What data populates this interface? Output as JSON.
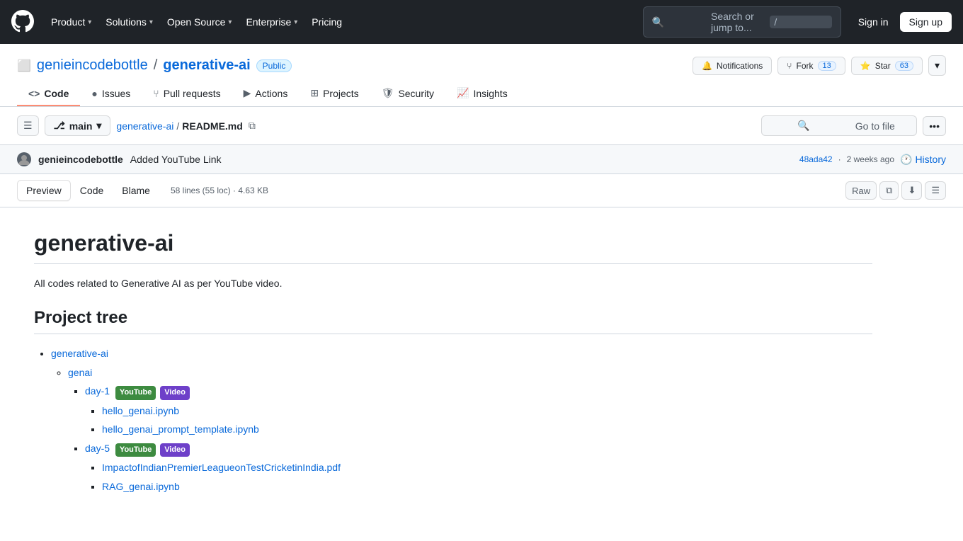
{
  "app": {
    "title": "GitHub",
    "logo_label": "GitHub logo"
  },
  "nav": {
    "items": [
      {
        "label": "Product",
        "has_dropdown": true
      },
      {
        "label": "Solutions",
        "has_dropdown": true
      },
      {
        "label": "Open Source",
        "has_dropdown": true
      },
      {
        "label": "Enterprise",
        "has_dropdown": true
      },
      {
        "label": "Pricing",
        "has_dropdown": false
      }
    ],
    "search_placeholder": "Search or jump to...",
    "search_shortcut": "/",
    "signin_label": "Sign in",
    "signup_label": "Sign up"
  },
  "repo": {
    "owner": "genieincodebottle",
    "name": "generative-ai",
    "visibility": "Public",
    "notifications_label": "Notifications",
    "fork_label": "Fork",
    "fork_count": "13",
    "star_label": "Star",
    "star_count": "63",
    "tabs": [
      {
        "label": "Code",
        "icon": "code-icon",
        "active": true
      },
      {
        "label": "Issues",
        "icon": "issue-icon",
        "active": false
      },
      {
        "label": "Pull requests",
        "icon": "pr-icon",
        "active": false
      },
      {
        "label": "Actions",
        "icon": "actions-icon",
        "active": false
      },
      {
        "label": "Projects",
        "icon": "projects-icon",
        "active": false
      },
      {
        "label": "Security",
        "icon": "security-icon",
        "active": false
      },
      {
        "label": "Insights",
        "icon": "insights-icon",
        "active": false
      }
    ]
  },
  "toolbar": {
    "branch": "main",
    "breadcrumb_repo": "generative-ai",
    "breadcrumb_file": "README.md",
    "go_to_file": "Go to file"
  },
  "commit": {
    "author": "genieincodebottle",
    "message": "Added YouTube Link",
    "sha": "48ada42",
    "time": "2 weeks ago",
    "history_label": "History"
  },
  "file": {
    "tabs": [
      {
        "label": "Preview",
        "active": true
      },
      {
        "label": "Code",
        "active": false
      },
      {
        "label": "Blame",
        "active": false
      }
    ],
    "meta": "58 lines (55 loc) · 4.63 KB",
    "raw_label": "Raw"
  },
  "readme": {
    "title": "generative-ai",
    "description": "All codes related to Generative AI as per YouTube video.",
    "section_title": "Project tree",
    "tree": {
      "root": "generative-ai",
      "items": [
        {
          "name": "genai",
          "children": [
            {
              "name": "day-1",
              "badges": [
                "YouTube",
                "Video"
              ],
              "children": [
                {
                  "name": "hello_genai.ipynb"
                },
                {
                  "name": "hello_genai_prompt_template.ipynb"
                }
              ]
            },
            {
              "name": "day-5",
              "badges": [
                "YouTube",
                "Video"
              ],
              "children": [
                {
                  "name": "ImpactofIndianPremierLeagueonTestCricketinIndia.pdf"
                },
                {
                  "name": "RAG_genai.ipynb"
                }
              ]
            }
          ]
        }
      ]
    }
  }
}
